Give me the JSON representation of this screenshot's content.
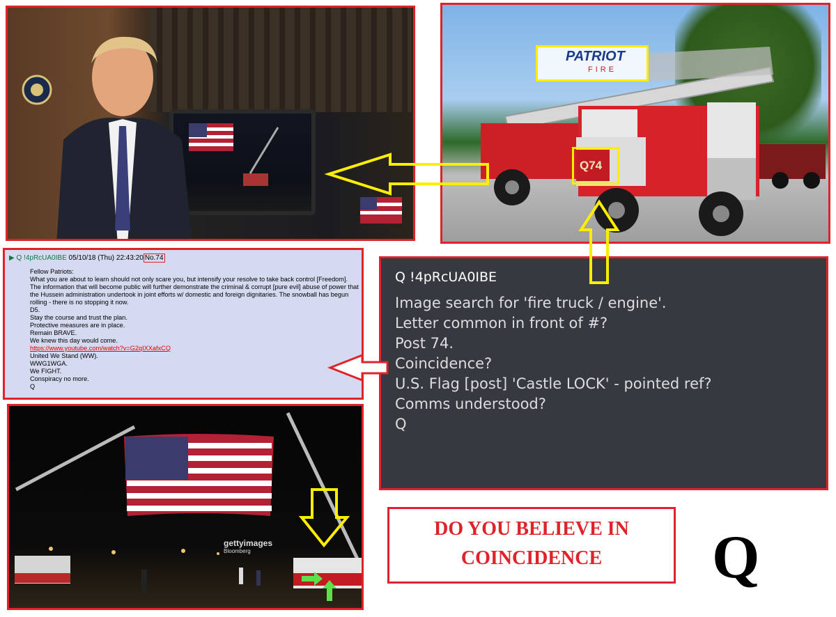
{
  "interior_photo": {
    "seal_icon": "presidential-seal-icon"
  },
  "truck_photo": {
    "sign_text": "PATRIOT",
    "unit_number": "Q74",
    "sign_lower": "FIRE"
  },
  "qpost": {
    "author": "Q !4pRcUA0IBE",
    "date": "05/10/18 (Thu) 22:43:20",
    "number": "No.74",
    "lines": [
      "Fellow Patriots:",
      "What you are about to learn should not only scare you, but intensify your resolve to take back control [Freedom]. The information that will become public will further demonstrate the criminal & corrupt [pure evil] abuse of power that the Hussein administration undertook in joint efforts w/ domestic and foreign dignitaries. The snowball has begun rolling - there is no stopping it now.",
      "D5.",
      "Stay the course and trust the plan.",
      "Protective measures are in place.",
      "Remain BRAVE.",
      "We knew this day would come.",
      "https://www.youtube.com/watch?v=G2qIXXafxCQ",
      "United We Stand (WW).",
      "WWG1WGA.",
      "We FIGHT.",
      "Conspiracy no more.",
      "Q"
    ]
  },
  "dark_message": {
    "name": "Q !4pRcUA0IBE",
    "lines": [
      "Image search for 'fire truck / engine'.",
      "Letter common in front of #?",
      "Post 74.",
      "Coincidence?",
      "U.S. Flag [post] 'Castle LOCK' - pointed ref?",
      "Comms understood?",
      "Q"
    ]
  },
  "night_photo": {
    "watermark": "gettyimages",
    "watermark_sub": "Bloomberg"
  },
  "title": {
    "line1": "DO YOU BELIEVE IN",
    "line2": "COINCIDENCE"
  },
  "big_letter": "Q",
  "colors": {
    "frame_red": "#e0222a",
    "highlight_yellow": "#ffee00",
    "dark_card": "#36393f",
    "post_bg": "#d6daf0"
  }
}
